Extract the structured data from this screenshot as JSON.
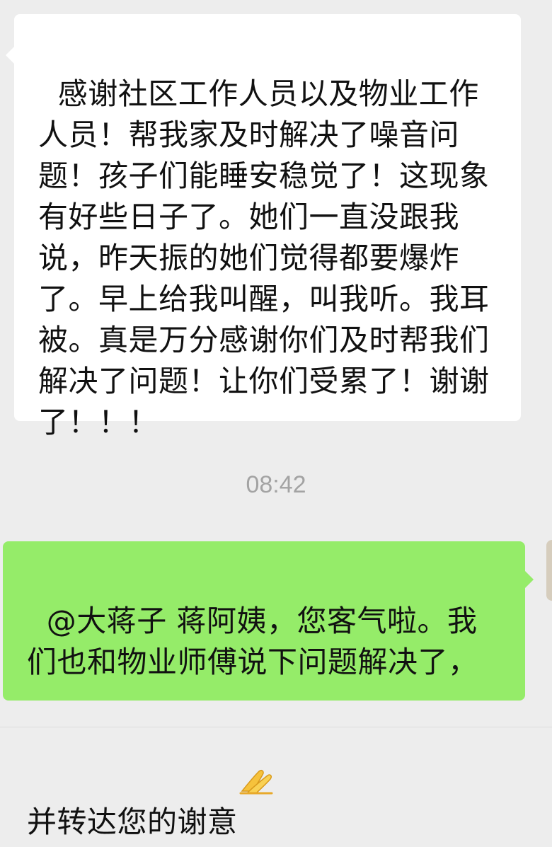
{
  "chat": {
    "incoming_message": "感谢社区工作人员以及物业工作人员！帮我家及时解决了噪音问题！孩子们能睡安稳觉了！这现象有好些日子了。她们一直没跟我说，昨天振的她们觉得都要爆炸了。早上给我叫醒，叫我听。我耳被。真是万分感谢你们及时帮我们解决了问题！让你们受累了！谢谢了！！！",
    "timestamp": "08:42",
    "outgoing_message": "@大蒋子 蒋阿姨，您客气啦。我们也和物业师傅说下问题解决了，并转达您的谢意",
    "outgoing_emoji": "folded-hands-icon"
  },
  "colors": {
    "background": "#ededed",
    "incoming_bubble": "#ffffff",
    "outgoing_bubble": "#95ec69",
    "timestamp_text": "#a3a3a3"
  }
}
